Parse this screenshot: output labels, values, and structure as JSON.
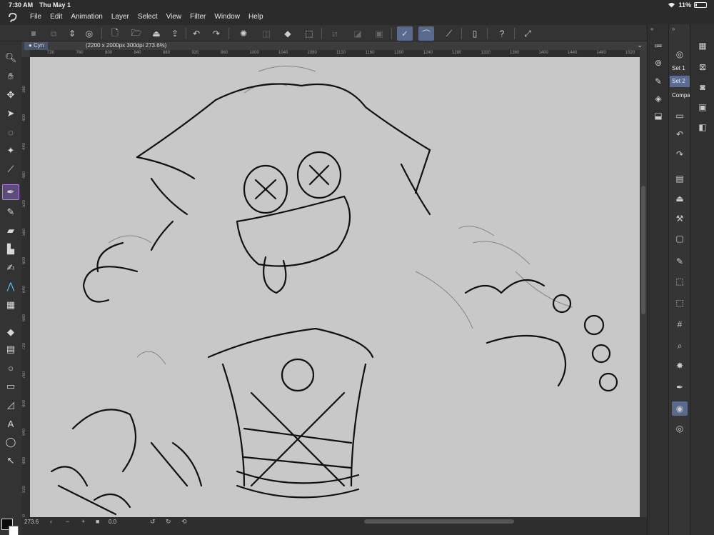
{
  "status": {
    "time": "7:30 AM",
    "date": "Thu May 1",
    "battery": "11%",
    "battery_level": 0.11
  },
  "menu": [
    "File",
    "Edit",
    "Animation",
    "Layer",
    "Select",
    "View",
    "Filter",
    "Window",
    "Help"
  ],
  "document": {
    "tab_name": "Cyn",
    "info": "(2200 x 2000px 300dpi 273.6%)"
  },
  "ruler_h": [
    "720",
    "760",
    "800",
    "840",
    "880",
    "920",
    "960",
    "1000",
    "1040",
    "1080",
    "1120",
    "1160",
    "1200",
    "1240",
    "1280",
    "1320",
    "1360",
    "1400",
    "1440",
    "1480",
    "1520"
  ],
  "ruler_v": [
    "360",
    "400",
    "440",
    "480",
    "520",
    "560",
    "600",
    "640",
    "680",
    "720",
    "760",
    "800",
    "840",
    "880",
    "920",
    "960"
  ],
  "bottom": {
    "zoom": "273.6",
    "angle": "0.0"
  },
  "sub_tool_sets": [
    {
      "label": "Set 1",
      "active": false
    },
    {
      "label": "Set 2",
      "active": true
    },
    {
      "label": "Compa",
      "active": false
    }
  ],
  "colors": {
    "accent": "#5a6a8e",
    "active_tool": "#b47ce8",
    "canvas": "#c8c8c8"
  }
}
